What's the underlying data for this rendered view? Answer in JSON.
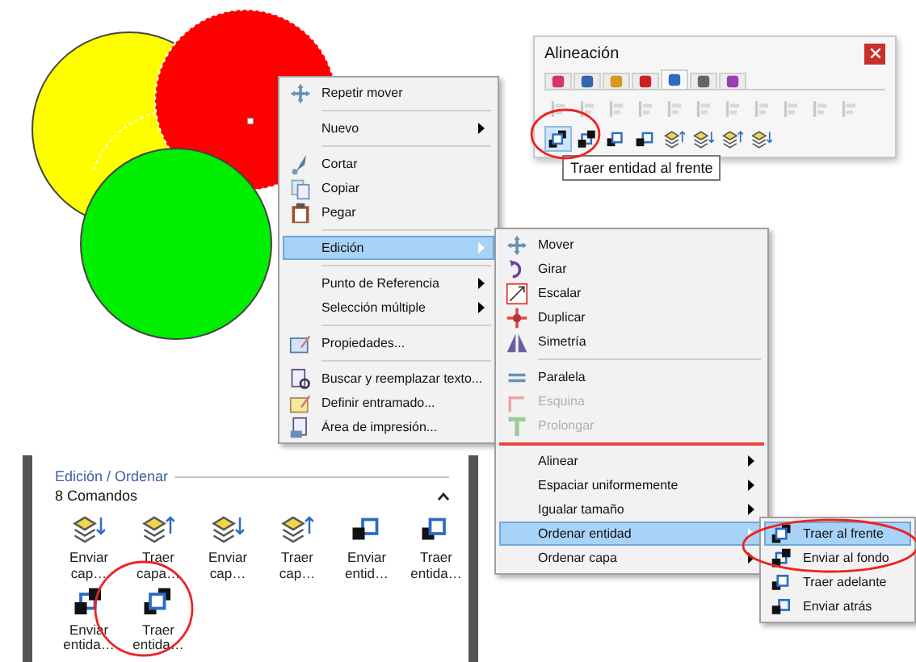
{
  "context_menu": {
    "groups": [
      [
        {
          "label": "Repetir mover",
          "submenu": false,
          "selected": false,
          "disabled": false
        }
      ],
      [
        {
          "label": "Nuevo",
          "submenu": true,
          "selected": false,
          "disabled": false
        }
      ],
      [
        {
          "label": "Cortar",
          "submenu": false,
          "selected": false,
          "disabled": false
        },
        {
          "label": "Copiar",
          "submenu": false,
          "selected": false,
          "disabled": false
        },
        {
          "label": "Pegar",
          "submenu": false,
          "selected": false,
          "disabled": false
        }
      ],
      [
        {
          "label": "Edición",
          "submenu": true,
          "selected": true,
          "disabled": false
        }
      ],
      [
        {
          "label": "Punto de Referencia",
          "submenu": true,
          "selected": false,
          "disabled": false
        },
        {
          "label": "Selección múltiple",
          "submenu": true,
          "selected": false,
          "disabled": false
        }
      ],
      [
        {
          "label": "Propiedades...",
          "submenu": false,
          "selected": false,
          "disabled": false
        }
      ],
      [
        {
          "label": "Buscar y reemplazar texto...",
          "submenu": false,
          "selected": false,
          "disabled": false
        },
        {
          "label": "Definir entramado...",
          "submenu": false,
          "selected": false,
          "disabled": false
        },
        {
          "label": "Área de impresión...",
          "submenu": false,
          "selected": false,
          "disabled": false
        }
      ]
    ]
  },
  "edit_submenu": {
    "groups": [
      [
        {
          "label": "Mover",
          "submenu": false,
          "selected": false,
          "disabled": false
        },
        {
          "label": "Girar",
          "submenu": false,
          "selected": false,
          "disabled": false
        },
        {
          "label": "Escalar",
          "submenu": false,
          "selected": false,
          "disabled": false
        },
        {
          "label": "Duplicar",
          "submenu": false,
          "selected": false,
          "disabled": false
        },
        {
          "label": "Simetría",
          "submenu": false,
          "selected": false,
          "disabled": false
        }
      ],
      [
        {
          "label": "Paralela",
          "submenu": false,
          "selected": false,
          "disabled": false
        },
        {
          "label": "Esquina",
          "submenu": false,
          "selected": false,
          "disabled": true
        },
        {
          "label": "Prolongar",
          "submenu": false,
          "selected": false,
          "disabled": true
        }
      ],
      [
        {
          "label": "Alinear",
          "submenu": true,
          "selected": false,
          "disabled": false
        },
        {
          "label": "Espaciar uniformemente",
          "submenu": true,
          "selected": false,
          "disabled": false
        },
        {
          "label": "Igualar tamaño",
          "submenu": true,
          "selected": false,
          "disabled": false
        },
        {
          "label": "Ordenar entidad",
          "submenu": true,
          "selected": true,
          "disabled": false
        },
        {
          "label": "Ordenar capa",
          "submenu": true,
          "selected": false,
          "disabled": false
        }
      ]
    ]
  },
  "order_submenu": {
    "groups": [
      [
        {
          "label": "Traer al frente",
          "submenu": false,
          "selected": true,
          "disabled": false
        },
        {
          "label": "Enviar al fondo",
          "submenu": false,
          "selected": false,
          "disabled": false
        },
        {
          "label": "Traer adelante",
          "submenu": false,
          "selected": false,
          "disabled": false
        },
        {
          "label": "Enviar atrás",
          "submenu": false,
          "selected": false,
          "disabled": false
        }
      ]
    ]
  },
  "alignment_panel": {
    "title": "Alineación",
    "tabs": [
      {
        "selected": false
      },
      {
        "selected": false
      },
      {
        "selected": false
      },
      {
        "selected": false
      },
      {
        "selected": true
      },
      {
        "selected": false
      },
      {
        "selected": false
      }
    ],
    "toolbar_row_1": [
      {
        "disabled": true
      },
      {
        "disabled": true
      },
      {
        "disabled": true
      },
      {
        "disabled": true
      },
      {
        "disabled": true
      },
      {
        "disabled": true
      },
      {
        "disabled": true
      },
      {
        "disabled": true
      },
      {
        "disabled": true
      },
      {
        "disabled": true
      },
      {
        "disabled": true
      }
    ],
    "toolbar_row_2": [
      {
        "selected": true
      },
      {
        "selected": false
      },
      {
        "selected": false
      },
      {
        "selected": false
      },
      {
        "selected": false
      },
      {
        "selected": false
      },
      {
        "selected": false
      },
      {
        "selected": false
      }
    ],
    "tooltip": "Traer entidad al frente"
  },
  "command_panel": {
    "heading": "Edición / Ordenar",
    "count": "8 Comandos",
    "expanded": true,
    "commands": [
      {
        "label": "Enviar cap…"
      },
      {
        "label": "Traer capa…"
      },
      {
        "label": "Enviar cap…"
      },
      {
        "label": "Traer cap…"
      },
      {
        "label": "Enviar entid…"
      },
      {
        "label": "Traer entida…"
      },
      {
        "label": "Enviar entida…"
      },
      {
        "label": "Traer entida…"
      }
    ]
  }
}
